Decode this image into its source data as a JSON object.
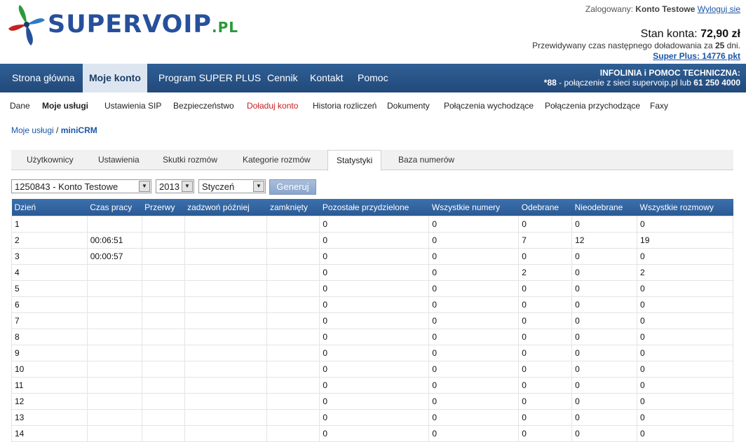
{
  "header": {
    "logo_text": "SUPERVOIP",
    "logo_suffix": ".PL",
    "login_prefix": "Zalogowany:",
    "user_name": "Konto Testowe",
    "logout": "Wyloguj sie",
    "balance_label": "Stan konta:",
    "balance_value": "72,90 zł",
    "next_topup_text": "Przewidywany czas następnego doładowania za",
    "next_topup_days": "25",
    "next_topup_unit": "dni.",
    "superplus_label": "Super Plus:",
    "superplus_value": "14776 pkt"
  },
  "nav": {
    "items": [
      "Strona główna",
      "Moje konto",
      "Program SUPER PLUS",
      "Cennik",
      "Kontakt",
      "Pomoc"
    ],
    "hotline_title": "INFOLINIA i POMOC TECHNICZNA:",
    "hotline_code": "*88",
    "hotline_text": "- połączenie z sieci supervoip.pl lub",
    "hotline_phone": "61 250 4000"
  },
  "subnav": {
    "items": [
      "Dane",
      "Moje usługi",
      "Ustawienia SIP",
      "Bezpieczeństwo",
      "Doładuj konto",
      "Historia rozliczeń",
      "Dokumenty",
      "Połączenia wychodzące",
      "Połączenia przychodzące",
      "Faxy"
    ]
  },
  "breadcrumb": {
    "parent": "Moje usługi",
    "separator": "/",
    "current": "miniCRM"
  },
  "tabs": [
    "Użytkownicy",
    "Ustawienia",
    "Skutki rozmów",
    "Kategorie rozmów",
    "Statystyki",
    "Baza numerów"
  ],
  "filters": {
    "account": "1250843 - Konto Testowe",
    "year": "2013",
    "month": "Styczeń",
    "generate": "Generuj"
  },
  "table": {
    "columns": [
      "Dzień",
      "Czas pracy",
      "Przerwy",
      "zadzwoń później",
      "zamknięty",
      "Pozostałe przydzielone",
      "Wszystkie numery",
      "Odebrane",
      "Nieodebrane",
      "Wszystkie rozmowy"
    ],
    "rows": [
      [
        "1",
        "",
        "",
        "",
        "",
        "0",
        "0",
        "0",
        "0",
        "0"
      ],
      [
        "2",
        "00:06:51",
        "",
        "",
        "",
        "0",
        "0",
        "7",
        "12",
        "19"
      ],
      [
        "3",
        "00:00:57",
        "",
        "",
        "",
        "0",
        "0",
        "0",
        "0",
        "0"
      ],
      [
        "4",
        "",
        "",
        "",
        "",
        "0",
        "0",
        "2",
        "0",
        "2"
      ],
      [
        "5",
        "",
        "",
        "",
        "",
        "0",
        "0",
        "0",
        "0",
        "0"
      ],
      [
        "6",
        "",
        "",
        "",
        "",
        "0",
        "0",
        "0",
        "0",
        "0"
      ],
      [
        "7",
        "",
        "",
        "",
        "",
        "0",
        "0",
        "0",
        "0",
        "0"
      ],
      [
        "8",
        "",
        "",
        "",
        "",
        "0",
        "0",
        "0",
        "0",
        "0"
      ],
      [
        "9",
        "",
        "",
        "",
        "",
        "0",
        "0",
        "0",
        "0",
        "0"
      ],
      [
        "10",
        "",
        "",
        "",
        "",
        "0",
        "0",
        "0",
        "0",
        "0"
      ],
      [
        "11",
        "",
        "",
        "",
        "",
        "0",
        "0",
        "0",
        "0",
        "0"
      ],
      [
        "12",
        "",
        "",
        "",
        "",
        "0",
        "0",
        "0",
        "0",
        "0"
      ],
      [
        "13",
        "",
        "",
        "",
        "",
        "0",
        "0",
        "0",
        "0",
        "0"
      ],
      [
        "14",
        "",
        "",
        "",
        "",
        "0",
        "0",
        "0",
        "0",
        "0"
      ]
    ]
  }
}
